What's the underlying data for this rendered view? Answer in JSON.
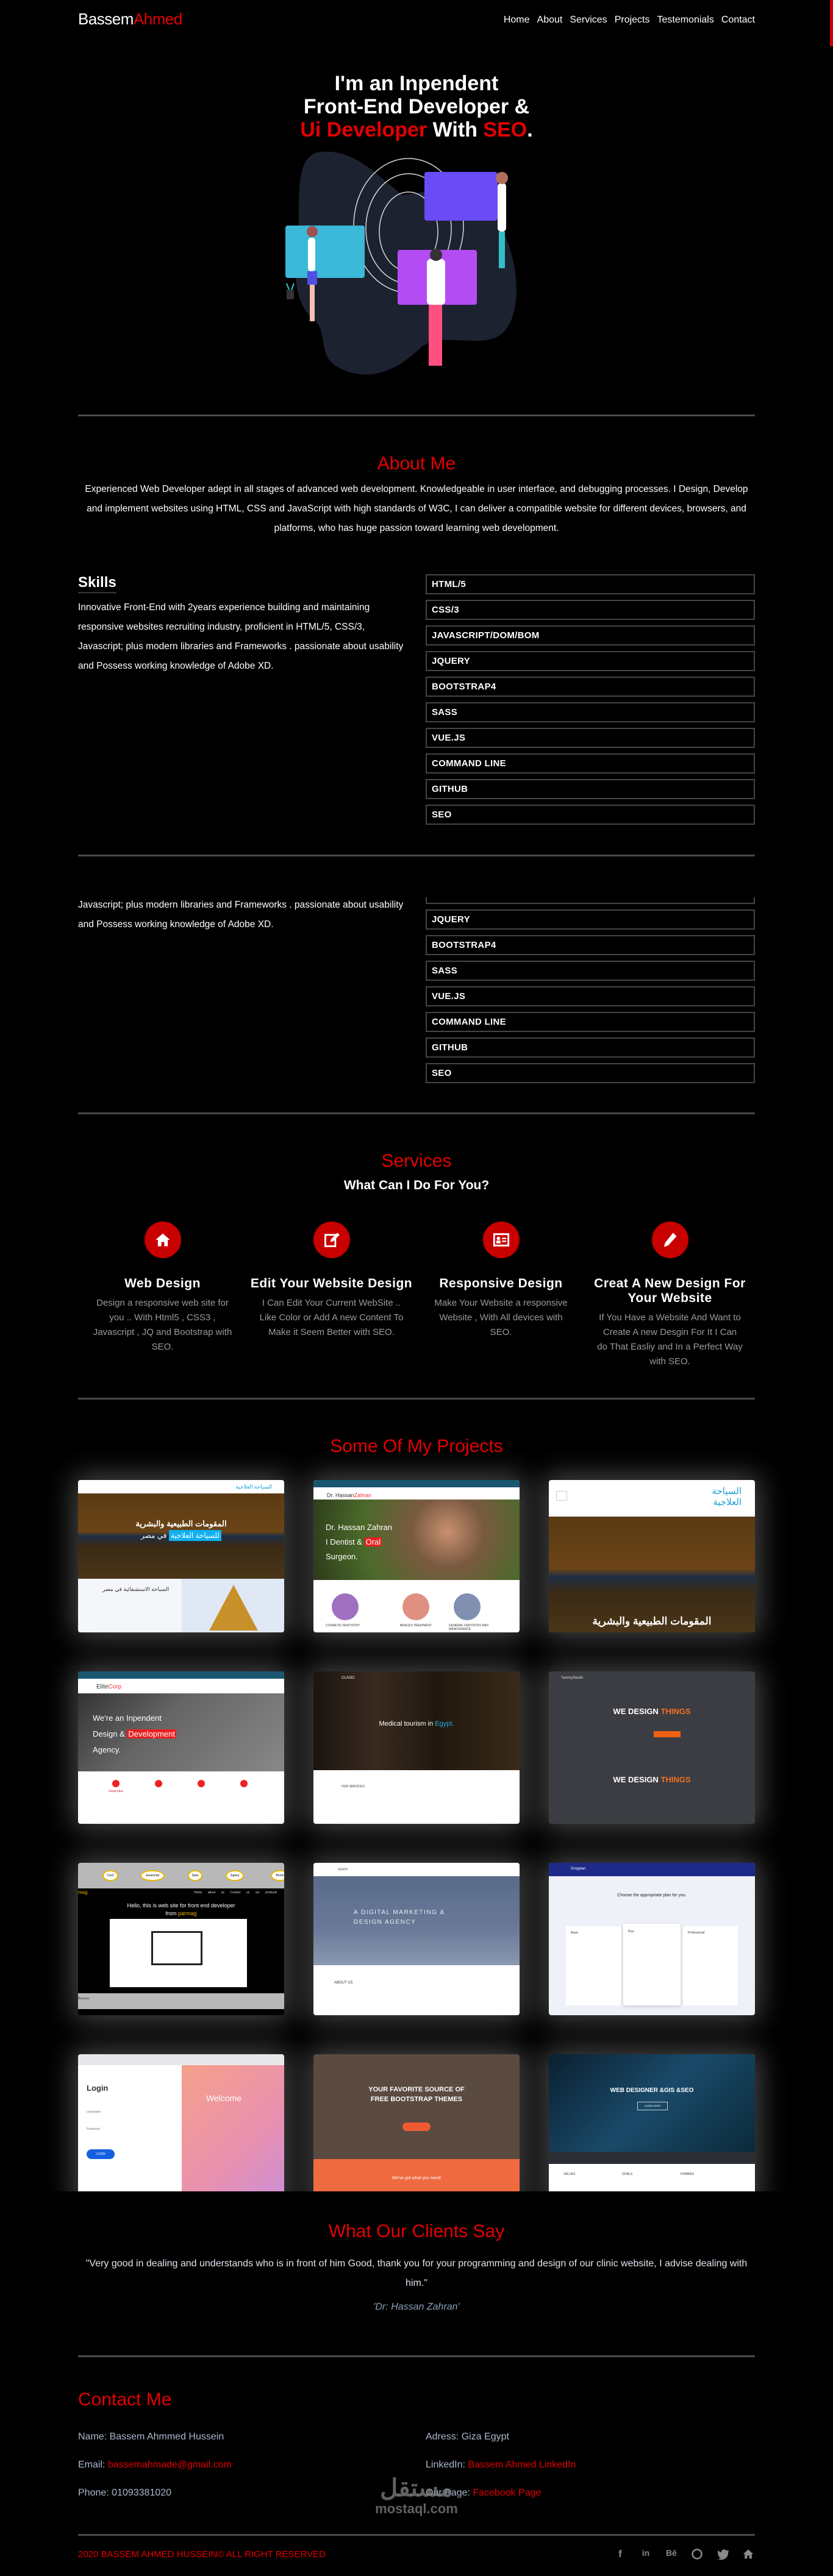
{
  "brand": {
    "first": "Bassem",
    "second": "Ahmed"
  },
  "nav": [
    "Home",
    "About",
    "Services",
    "Projects",
    "Testemonials",
    "Contact"
  ],
  "hero": {
    "line1": "I'm an Inpendent",
    "line2": "Front-End Developer &",
    "line3_red1": "Ui Developer",
    "line3_white": " With ",
    "line3_red2": "SEO",
    "line3_end": "."
  },
  "about": {
    "title": "About Me",
    "text": "Experienced Web Developer adept in all stages of advanced web development. Knowledgeable in user interface, and debugging processes. I Design, Develop and implement websites using HTML, CSS and JavaScript with high standards of W3C, I can deliver a compatible website for different devices, browsers, and platforms, who has huge passion toward learning web development."
  },
  "skills": {
    "title": "Skills",
    "text": "Innovative Front-End with 2years experience building and maintaining responsive websites recruiting industry, proficient in HTML/5, CSS/3, Javascript; plus modern libraries and Frameworks . passionate about usability and Possess working knowledge of Adobe XD.",
    "items": [
      "HTML/5",
      "CSS/3",
      "JAVASCRIPT/DOM/BOM",
      "JQUERY",
      "BOOTSTRAP4",
      "SASS",
      "VUE.JS",
      "COMMAND LINE",
      "GITHUB",
      "SEO"
    ]
  },
  "services": {
    "title": "Services",
    "subtitle": "What Can I Do For You?",
    "items": [
      {
        "icon": "home-icon",
        "title": "Web Design",
        "text": "Design a responsive web site for you .. With Html5 , CSS3 , Javascript , JQ and Bootstrap with SEO."
      },
      {
        "icon": "edit-icon",
        "title": "Edit Your Website Design",
        "text": "I Can Edit Your Current WebSite .. Like Color or Add A new Content To Make it Seem Better with SEO."
      },
      {
        "icon": "id-card-icon",
        "title": "Responsive Design",
        "text": "Make Your Website a responsive Website , With All devices with SEO."
      },
      {
        "icon": "pen-icon",
        "title": "Creat A New Design For Your Website",
        "text": "If You Have a Website And Want to Create A new Desgin For It I Can do That Easliy and In a Perfect Way with SEO."
      }
    ]
  },
  "projects": {
    "title": "Some Of My Projects",
    "cards": [
      {
        "logo": "السياحة العلاجية",
        "headline": "المقومات الطبيعية والبشرية",
        "highlight": "للسياحة العلاجية",
        "tail": "في مصر",
        "section": "السياحة الاستشفائية في مصر"
      },
      {
        "logo1": "Dr. Hassan",
        "logo2": "Zahran",
        "l1": "Dr. Hassan Zahran",
        "l2": "I Dentist & ",
        "l2red": "Oral",
        "l3": "Surgeon.",
        "s1": "COSMETIC DENTISTRY",
        "s2": "BRACES TREATMENT",
        "s3": "GENERAL DENTISTRY AND MAINTENANCE"
      },
      {
        "logo": "السياحة العلاجية",
        "headline": "المقومات الطبيعية والبشرية"
      },
      {
        "logo1": "Elite",
        "logo2": "Corp",
        "l1": "We're an Inpendent",
        "l2": "Design & ",
        "l2red": "Development",
        "l3": "Agency.",
        "feature": "Great Idea"
      },
      {
        "logo": "CLASIC",
        "headline": "Medical tourism in ",
        "accent": "Egypt.",
        "section": "OUR SERVICES"
      },
      {
        "logo": "TammyStudio",
        "h1": "WE DESIGN ",
        "h1o": "THINGS"
      },
      {
        "pills": [
          "Css3",
          "Javascript",
          "Sass",
          "Jquery",
          "Boots"
        ],
        "logo": "mag",
        "links": [
          "Home",
          "about us",
          "Contact us",
          "our products"
        ],
        "h1": "Hello, this is web site for front end developer",
        "h2": "from ",
        "h2o": "parmag",
        "foot": "Bassem."
      },
      {
        "logo": "space",
        "h1": "A DIGITAL MARKETING &",
        "h2": "DESIGN AGENCY",
        "about": "ABOUT US"
      },
      {
        "logo": "Dropplan",
        "h1": "Choose the appropriate plan for you.",
        "plans": [
          "Basic",
          "Plus",
          "Professional"
        ]
      },
      {
        "title": "Login",
        "user": "Username",
        "pass": "Password",
        "btn": "LOGIN",
        "welcome": "Welcome"
      },
      {
        "h1": "YOUR FAVORITE SOURCE OF",
        "h2": "FREE BOOTSTRAP THEMES",
        "band": "We've got what you need!"
      },
      {
        "h1": "WEB DESIGNER &GIS &SEO",
        "btn": "LEARN MORE",
        "cols": [
          "VALUES",
          "GOALS",
          "HOBBIES"
        ]
      }
    ]
  },
  "testimonials": {
    "title": "What Our Clients Say",
    "quote": "\"Very good in dealing and understands who is in front of him Good, thank you for your programming and design of our clinic website, I advise dealing with him.\"",
    "author": "'Dr: Hassan Zahran'"
  },
  "contact": {
    "title": "Contact Me",
    "name_label": "Name: ",
    "name": "Bassem Ahmmed Hussein",
    "email_label": "Email: ",
    "email": "bassemahmade@gmail.com",
    "phone_label": "Phone: ",
    "phone": "01093381020",
    "address_label": "Adress: ",
    "address": "Giza Egypt",
    "linkedin_label": "LinkedIn: ",
    "linkedin": "Bassem Ahmed LinkedIn",
    "page_label": "Our Page: ",
    "page": "Facebook Page"
  },
  "watermark": {
    "arabic": "مستقل",
    "latin": "mostaql.com"
  },
  "footer": {
    "copyright": "2020 BASSEM AHMED HUSSEIN© ALL RIGHT RESERVED",
    "social": [
      "facebook-icon",
      "linkedin-icon",
      "behance-icon",
      "github-icon",
      "twitter-icon",
      "home-icon"
    ]
  },
  "colors": {
    "accent": "#e40000",
    "background": "#000000",
    "icon_circle": "#c80000"
  }
}
